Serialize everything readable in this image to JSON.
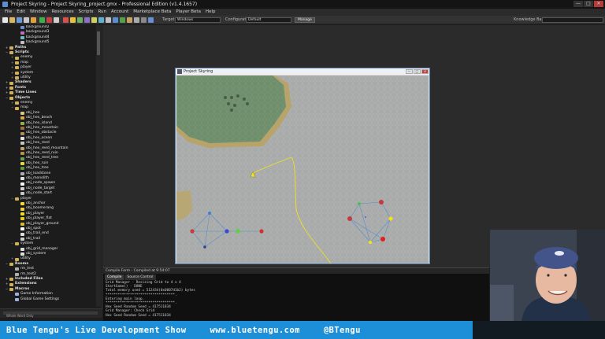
{
  "window": {
    "title": "Project Skyring - Project Skyring_project.gmx - Professional Edition (v1.4.1657)",
    "controls": [
      "—",
      "□",
      "✕"
    ]
  },
  "menu": [
    "File",
    "Edit",
    "Window",
    "Resources",
    "Scripts",
    "Run",
    "Account",
    "Marketplace Beta",
    "Player Beta",
    "Help"
  ],
  "toolbar": {
    "target_label": "Target",
    "target_value": "Windows",
    "config_label": "Configuration",
    "config_value": "Default",
    "manage_button": "Manage",
    "kb_label": "Knowledge Base"
  },
  "tree": [
    {
      "indent": 3,
      "label": "background2",
      "icon": "sprite",
      "color": "#6a8ecf"
    },
    {
      "indent": 3,
      "label": "background3",
      "icon": "sprite",
      "color": "#c06ec0"
    },
    {
      "indent": 3,
      "label": "background4",
      "icon": "sprite",
      "color": "#6ec0c0"
    },
    {
      "indent": 3,
      "label": "background5",
      "icon": "sprite",
      "color": "#c0c0c0"
    },
    {
      "indent": 1,
      "label": "Paths",
      "icon": "folder",
      "bold": true
    },
    {
      "indent": 1,
      "label": "Scripts",
      "icon": "folder",
      "bold": true,
      "expanded": true
    },
    {
      "indent": 2,
      "label": "enemy",
      "icon": "folder"
    },
    {
      "indent": 2,
      "label": "map",
      "icon": "folder"
    },
    {
      "indent": 2,
      "label": "player",
      "icon": "folder"
    },
    {
      "indent": 2,
      "label": "system",
      "icon": "folder"
    },
    {
      "indent": 2,
      "label": "utility",
      "icon": "folder"
    },
    {
      "indent": 1,
      "label": "Shaders",
      "icon": "folder",
      "bold": true
    },
    {
      "indent": 1,
      "label": "Fonts",
      "icon": "folder",
      "bold": true
    },
    {
      "indent": 1,
      "label": "Time Lines",
      "icon": "folder",
      "bold": true
    },
    {
      "indent": 1,
      "label": "Objects",
      "icon": "folder",
      "bold": true,
      "expanded": true
    },
    {
      "indent": 2,
      "label": "enemy",
      "icon": "folder"
    },
    {
      "indent": 2,
      "label": "map",
      "icon": "folder",
      "expanded": true
    },
    {
      "indent": 3,
      "label": "obj_hex",
      "icon": "obj",
      "color": "#d8c880"
    },
    {
      "indent": 3,
      "label": "obj_hex_beach",
      "icon": "obj",
      "color": "#d8a84a"
    },
    {
      "indent": 3,
      "label": "obj_hex_island",
      "icon": "obj",
      "color": "#8fb04a"
    },
    {
      "indent": 3,
      "label": "obj_hex_mountain",
      "icon": "obj",
      "color": "#a07040"
    },
    {
      "indent": 3,
      "label": "obj_hex_obstacle",
      "icon": "obj",
      "color": "#b08a60"
    },
    {
      "indent": 3,
      "label": "obj_hex_ocean",
      "icon": "obj",
      "color": "#e0e0e0"
    },
    {
      "indent": 3,
      "label": "obj_hex_reed",
      "icon": "obj",
      "color": "#c8c8c8"
    },
    {
      "indent": 3,
      "label": "obj_hex_reed_mountain",
      "icon": "obj",
      "color": "#c8a060"
    },
    {
      "indent": 3,
      "label": "obj_hex_reed_ruin",
      "icon": "obj",
      "color": "#b89050"
    },
    {
      "indent": 3,
      "label": "obj_hex_reed_tree",
      "icon": "obj",
      "color": "#6aa050"
    },
    {
      "indent": 3,
      "label": "obj_hex_ruin",
      "icon": "obj",
      "color": "#e8d840"
    },
    {
      "indent": 3,
      "label": "obj_hex_tree",
      "icon": "obj",
      "color": "#5a9a48"
    },
    {
      "indent": 3,
      "label": "obj_loadstone",
      "icon": "obj",
      "color": "#b0b0b0"
    },
    {
      "indent": 3,
      "label": "obj_monolith",
      "icon": "obj",
      "color": "#e0e0e0"
    },
    {
      "indent": 3,
      "label": "obj_node_spawn",
      "icon": "obj",
      "color": "#ffffff"
    },
    {
      "indent": 3,
      "label": "obj_node_target",
      "icon": "obj",
      "color": "#d0d0d0"
    },
    {
      "indent": 3,
      "label": "obj_node_start",
      "icon": "obj",
      "color": "#c8c8c8"
    },
    {
      "indent": 2,
      "label": "player",
      "icon": "folder",
      "expanded": true
    },
    {
      "indent": 3,
      "label": "obj_anchor",
      "icon": "obj",
      "color": "#f0e020"
    },
    {
      "indent": 3,
      "label": "obj_boomerang",
      "icon": "obj",
      "color": "#f0d040"
    },
    {
      "indent": 3,
      "label": "obj_player",
      "icon": "obj",
      "color": "#f0e020"
    },
    {
      "indent": 3,
      "label": "obj_player_flat",
      "icon": "obj",
      "color": "#e0d020"
    },
    {
      "indent": 3,
      "label": "obj_player_ground",
      "icon": "obj",
      "color": "#d8c020"
    },
    {
      "indent": 3,
      "label": "obj_spot",
      "icon": "obj",
      "color": "#ffffff"
    },
    {
      "indent": 3,
      "label": "obj_trail_end",
      "icon": "obj",
      "color": "#e0e0e0"
    },
    {
      "indent": 3,
      "label": "obj_trail",
      "icon": "obj",
      "color": "#d0d0d0"
    },
    {
      "indent": 2,
      "label": "system",
      "icon": "folder",
      "expanded": true
    },
    {
      "indent": 3,
      "label": "obj_grid_manager",
      "icon": "obj",
      "color": "#e0e0e0"
    },
    {
      "indent": 3,
      "label": "obj_system",
      "icon": "obj",
      "color": "#e0e0e0"
    },
    {
      "indent": 2,
      "label": "utility",
      "icon": "folder"
    },
    {
      "indent": 1,
      "label": "Rooms",
      "icon": "folder",
      "bold": true,
      "expanded": true
    },
    {
      "indent": 2,
      "label": "rm_test",
      "icon": "room",
      "color": "#b0b0b0"
    },
    {
      "indent": 2,
      "label": "rm_test2",
      "icon": "room",
      "color": "#b0b0b0"
    },
    {
      "indent": 1,
      "label": "Included Files",
      "icon": "folder",
      "bold": true
    },
    {
      "indent": 1,
      "label": "Extensions",
      "icon": "folder",
      "bold": true
    },
    {
      "indent": 1,
      "label": "Macros",
      "icon": "folder",
      "bold": true,
      "expanded": true
    },
    {
      "indent": 2,
      "label": "Game Information",
      "icon": "doc",
      "color": "#9bb3d8"
    },
    {
      "indent": 2,
      "label": "Global Game Settings",
      "icon": "doc",
      "color": "#9bb3d8"
    }
  ],
  "tree_bottom_label": "Whole Word Only",
  "game_window": {
    "title": "Project Skyring",
    "controls": [
      "—",
      "□",
      "✕"
    ]
  },
  "output": {
    "bar": "Compile Form - Compiled at 9:54:07",
    "tabs": [
      "Compile",
      "Source Control"
    ],
    "lines": [
      "Grid Manager - Resizing Grid to 4 x 4",
      "StartGame() - DONE",
      "Total memory used = 512434(0x0007d1b2) bytes",
      "**********************************.",
      "Entering main loop.",
      "**********************************.",
      "Hex Seed Random Seed = 417511834",
      "Grid Manager: Check Grid",
      "Hex Seed Random Seed = 417511834"
    ]
  },
  "banner": {
    "show": "Blue Tengu's Live Development Show",
    "site": "www.bluetengu.com",
    "handle": "@BTengu"
  }
}
